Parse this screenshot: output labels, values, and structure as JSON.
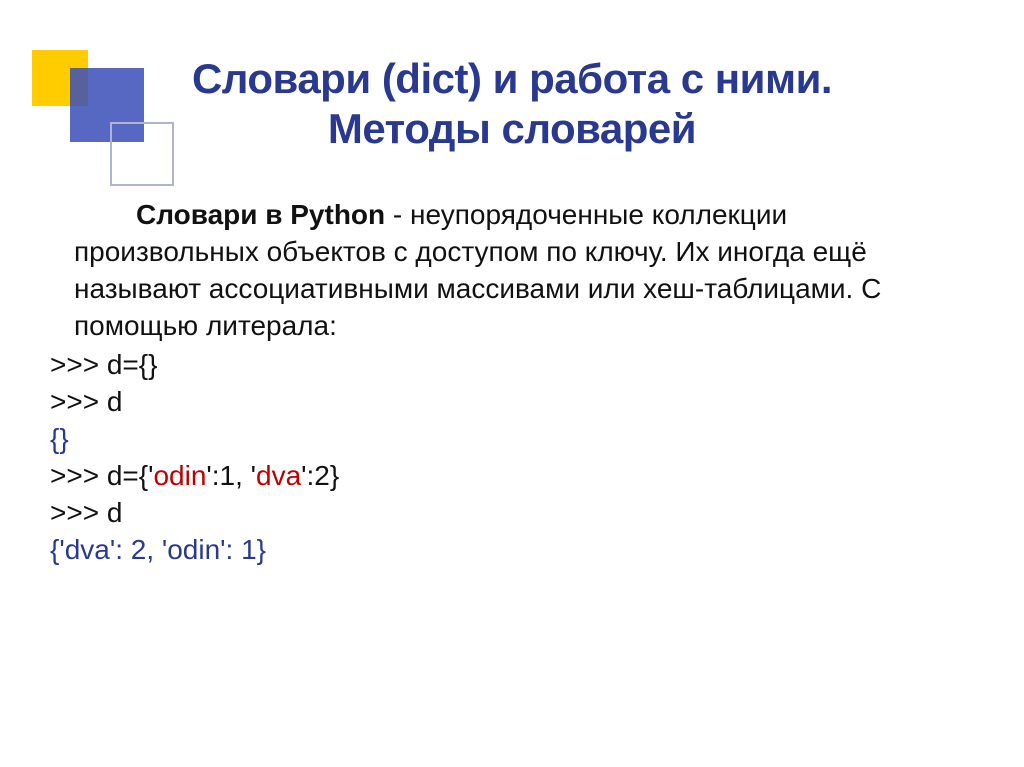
{
  "title_line1": "Словари (dict) и работа с ними.",
  "title_line2": "Методы словарей",
  "paragraph": {
    "strong_lead": "Словари в Python",
    "rest_first": " - неупорядоченные коллекции",
    "rest_lines": "произвольных объектов с доступом по ключу. Их иногда ещё называют ассоциативными массивами или хеш-таблицами. С помощью литерала:"
  },
  "code": {
    "l1": ">>> d={}",
    "l2": ">>> d",
    "l3": "{}",
    "l4a": ">>> d={'",
    "l4b": "odin",
    "l4c": "':1, '",
    "l4d": "dva",
    "l4e": "':2}",
    "l5": ">>> d",
    "l6": "{'dva': 2, 'odin': 1}"
  }
}
